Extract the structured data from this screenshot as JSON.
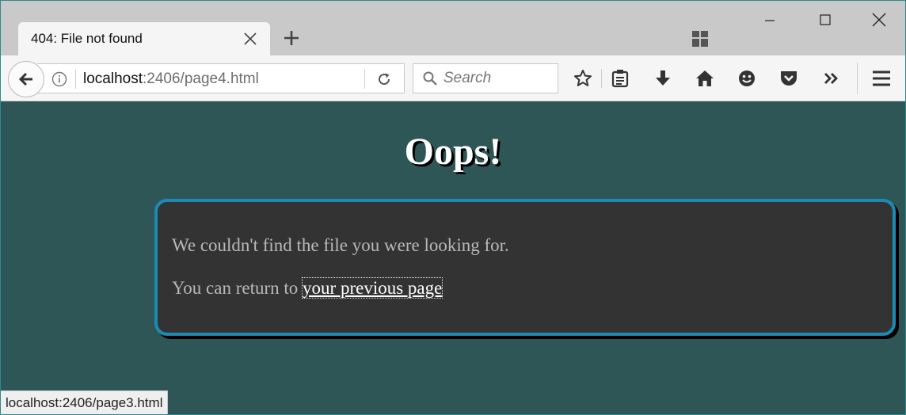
{
  "tab": {
    "title": "404: File not found"
  },
  "url": {
    "host": "localhost",
    "path": ":2406/page4.html"
  },
  "search": {
    "placeholder": "Search"
  },
  "page": {
    "title": "Oops!",
    "message_line1": "We couldn't find the file you were looking for.",
    "message_line2_prefix": "You can return to ",
    "link_text": "your previous page"
  },
  "status": {
    "hover_url": "localhost:2406/page3.html"
  },
  "icons": {
    "tab_close": "close-icon",
    "new_tab": "plus-icon",
    "tab_groups": "tiles-icon",
    "back": "arrow-left-icon",
    "info": "info-icon",
    "reload": "reload-icon",
    "search": "magnifier-icon",
    "bookmark": "star-icon",
    "reader": "clipboard-icon",
    "downloads": "download-icon",
    "home": "home-icon",
    "feedback": "smiley-icon",
    "pocket": "pocket-icon",
    "overflow": "chevron-double-right-icon",
    "menu": "hamburger-icon"
  },
  "colors": {
    "page_background": "#2f5656",
    "box_background": "#333333",
    "box_border": "#1b8bb5",
    "title_text": "#ffffff",
    "body_text": "#b8b8b8"
  }
}
